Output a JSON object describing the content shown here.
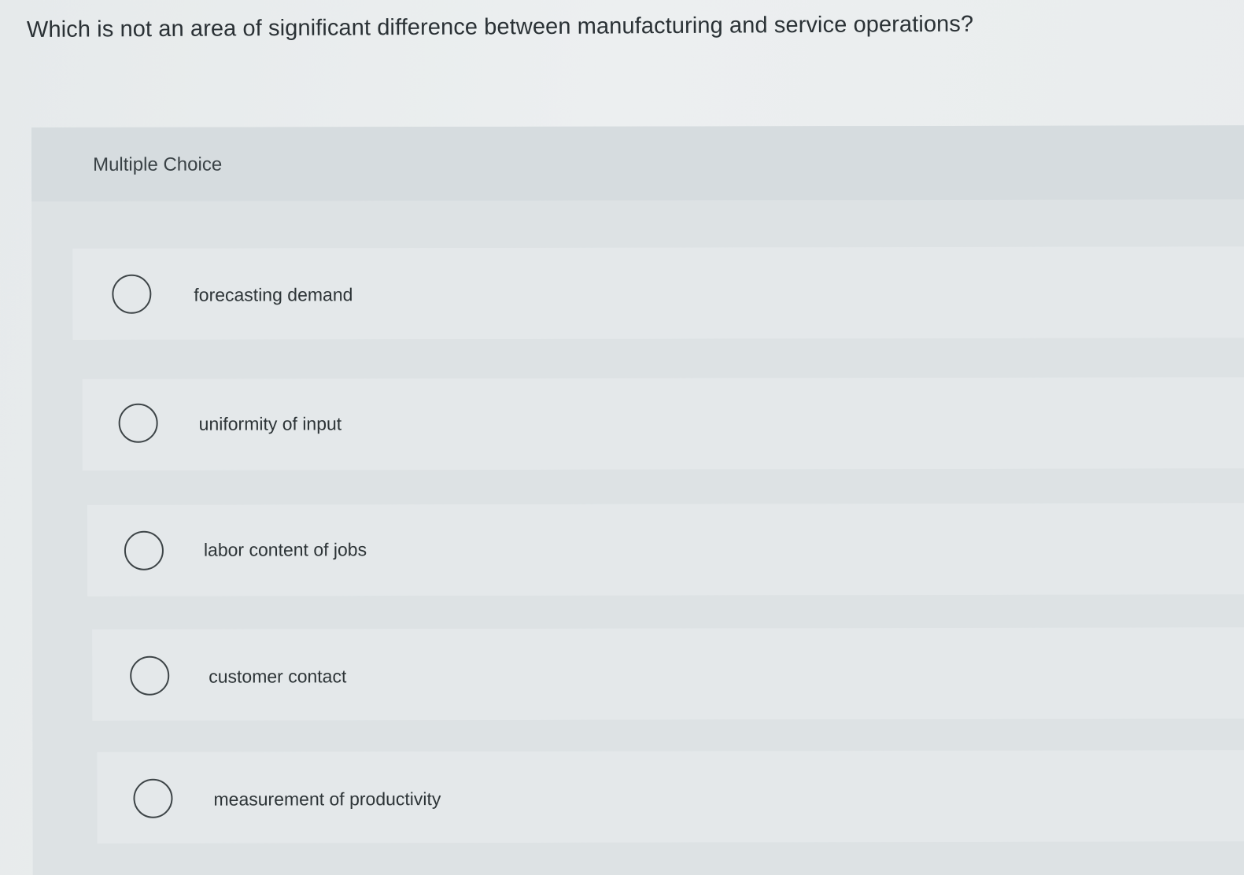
{
  "question": {
    "text": "Which is not an area of significant difference between manufacturing and service operations?"
  },
  "panel": {
    "title": "Multiple Choice"
  },
  "options": [
    {
      "label": "forecasting demand",
      "selected": false
    },
    {
      "label": "uniformity of input",
      "selected": false
    },
    {
      "label": "labor content of jobs",
      "selected": false
    },
    {
      "label": "customer contact",
      "selected": false
    },
    {
      "label": "measurement of productivity",
      "selected": false
    }
  ],
  "colors": {
    "page_background": "#e9eced",
    "panel_background": "#dde2e4",
    "panel_header": "#d6dcdf",
    "option_background": "#e4e8ea",
    "text": "#2e3538"
  }
}
